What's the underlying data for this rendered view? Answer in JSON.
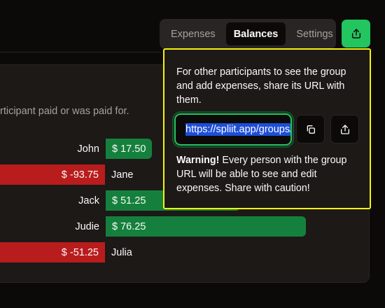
{
  "tabs": [
    {
      "label": "Expenses",
      "active": false
    },
    {
      "label": "Balances",
      "active": true
    },
    {
      "label": "Settings",
      "active": false
    }
  ],
  "share_button": {
    "icon": "share-icon",
    "color": "#22c55e"
  },
  "balances_card": {
    "description_fragment": "rticipant paid or was paid for."
  },
  "balances": [
    {
      "name": "John",
      "amount": "$ 17.50",
      "value": 17.5
    },
    {
      "name": "Jane",
      "amount": "$ -93.75",
      "value": -93.75
    },
    {
      "name": "Jack",
      "amount": "$ 51.25",
      "value": 51.25
    },
    {
      "name": "Judie",
      "amount": "$ 76.25",
      "value": 76.25
    },
    {
      "name": "Julia",
      "amount": "$ -51.25",
      "value": -51.25
    }
  ],
  "share_popover": {
    "intro": "For other participants to see the group and add expenses, share its URL with them.",
    "url": "https://spliit.app/groups/",
    "copy_icon": "copy-icon",
    "share_icon": "share-icon",
    "warning_title": "Warning!",
    "warning_text": "Every person with the group URL will be able to see and edit expenses. Share with caution!"
  },
  "colors": {
    "positive": "#15803d",
    "negative": "#b91c1c",
    "accent": "#22c55e",
    "highlight": "#f4f40a"
  }
}
